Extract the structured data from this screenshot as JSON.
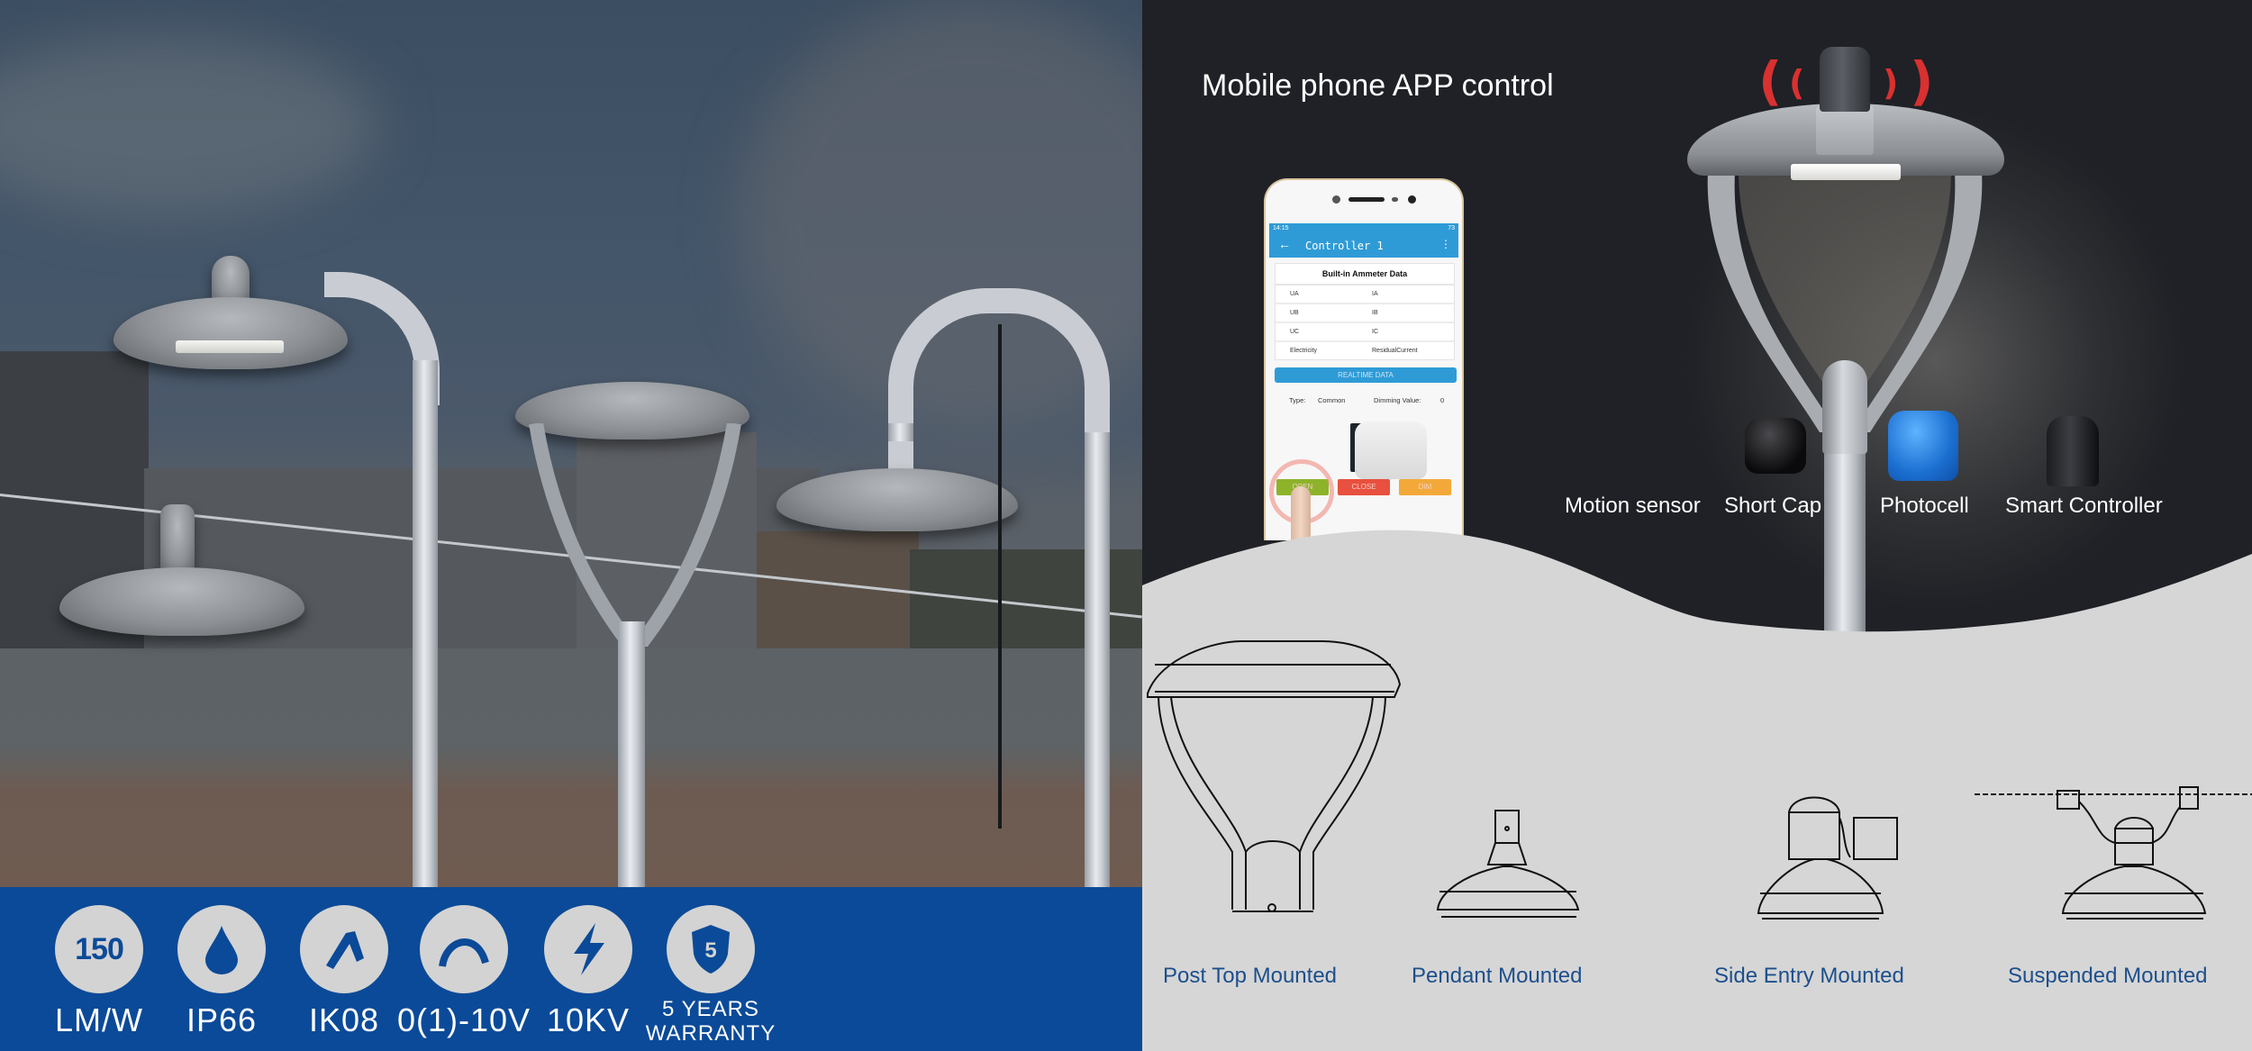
{
  "specs": [
    {
      "icon": "efficacy-150-icon",
      "icon_text": "150",
      "label": "LM/W"
    },
    {
      "icon": "water-drop-icon",
      "label": "IP66"
    },
    {
      "icon": "hammer-icon",
      "label": "IK08"
    },
    {
      "icon": "dimming-arc-icon",
      "label": "0(1)-10V"
    },
    {
      "icon": "lightning-icon",
      "label": "10KV"
    },
    {
      "icon": "warranty-shield-icon",
      "icon_text": "5",
      "label_line1": "5 YEARS",
      "label_line2": "WARRANTY"
    }
  ],
  "app_section": {
    "title": "Mobile phone APP control",
    "phone": {
      "status_time": "14:15",
      "battery": "73",
      "app_title": "Controller 1",
      "back_icon": "←",
      "more_icon": "⋮",
      "table_title": "Built-in Ammeter Data",
      "table_rows": [
        [
          "UA",
          "IA"
        ],
        [
          "UB",
          "IB"
        ],
        [
          "UC",
          "IC"
        ],
        [
          "Electricity",
          "ResidualCurrent"
        ]
      ],
      "realtime_button": "REALTIME DATA",
      "type_label": "Type:",
      "type_value": "Common",
      "dimming_label": "Dimming Value:",
      "dimming_value": "0",
      "buttons": {
        "open": "OPEN",
        "close": "CLOSE",
        "dim": "DIM"
      },
      "button_colors": {
        "open": "#8db32b",
        "close": "#e8503f",
        "dim": "#f3a93a"
      }
    }
  },
  "accessories": [
    {
      "name": "Motion sensor"
    },
    {
      "name": "Short Cap"
    },
    {
      "name": "Photocell"
    },
    {
      "name": "Smart Controller"
    }
  ],
  "mountings": [
    {
      "label": "Post Top Mounted"
    },
    {
      "label": "Pendant Mounted"
    },
    {
      "label": "Side Entry Mounted"
    },
    {
      "label": "Suspended Mounted"
    }
  ],
  "colors": {
    "spec_bar": "#0b4a98",
    "spec_circle": "#d3d3d3",
    "dark_panel": "#1f2126",
    "light_panel": "#d6d6d6",
    "mount_label": "#1d4f8c",
    "signal_red": "#d93030",
    "app_blue": "#2f9bd6"
  }
}
